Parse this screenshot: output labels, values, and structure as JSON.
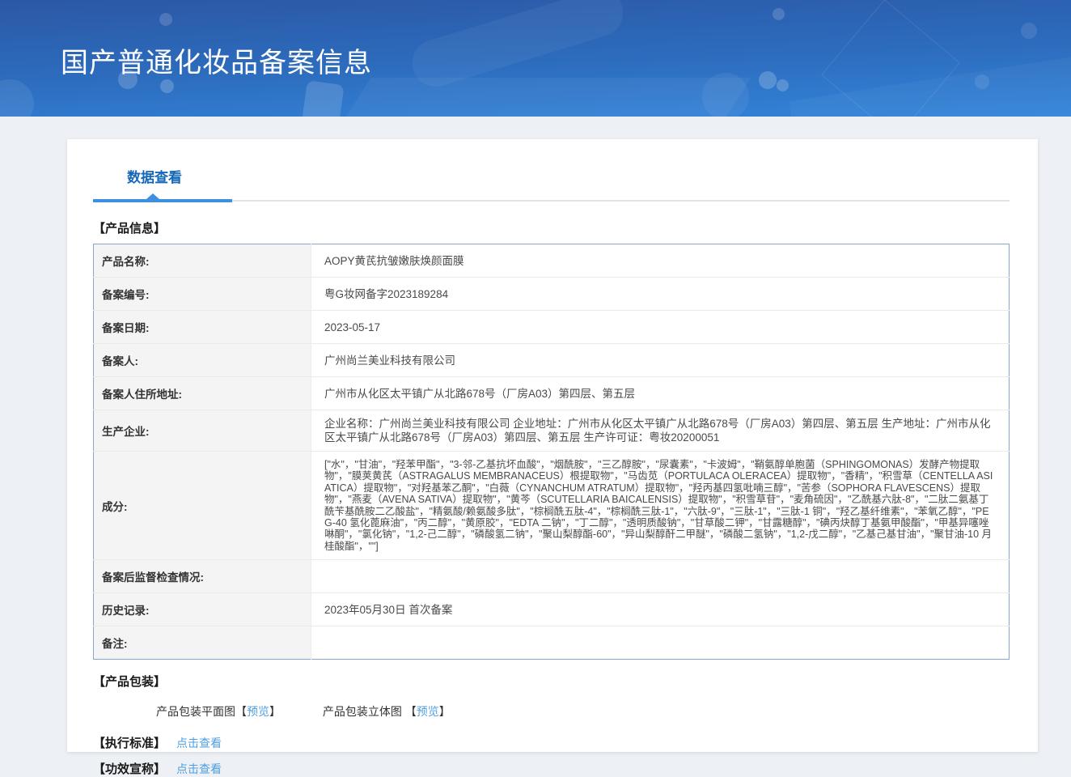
{
  "header": {
    "title": "国产普通化妆品备案信息"
  },
  "tab": {
    "label": "数据查看"
  },
  "product_info": {
    "title": "【产品信息】",
    "rows": [
      {
        "label": "产品名称:",
        "value": "AOPY黄芪抗皱嫩肤焕颜面膜"
      },
      {
        "label": "备案编号:",
        "value": "粤G妆网备字2023189284"
      },
      {
        "label": "备案日期:",
        "value": "2023-05-17"
      },
      {
        "label": "备案人:",
        "value": "广州尚兰美业科技有限公司"
      },
      {
        "label": "备案人住所地址:",
        "value": "广州市从化区太平镇广从北路678号（厂房A03）第四层、第五层"
      },
      {
        "label": "生产企业:",
        "value": "企业名称：广州尚兰美业科技有限公司 企业地址：广州市从化区太平镇广从北路678号（厂房A03）第四层、第五层 生产地址：广州市从化区太平镇广从北路678号（厂房A03）第四层、第五层 生产许可证：粤妆20200051"
      },
      {
        "label": "成分:",
        "value": "[\"水\"，\"甘油\"，\"羟苯甲酯\"，\"3-邻-乙基抗坏血酸\"，\"烟酰胺\"，\"三乙醇胺\"，\"尿囊素\"，\"卡波姆\"，\"鞘氨醇单胞菌（SPHINGOMONAS）发酵产物提取物\"，\"膜荚黄芪（ASTRAGALUS MEMBRANACEUS）根提取物\"，\"马齿苋（PORTULACA OLERACEA）提取物\"，\"香精\"，\"积雪草（CENTELLA ASIATICA）提取物\"，\"对羟基苯乙酮\"，\"白薇（CYNANCHUM ATRATUM）提取物\"，\"羟丙基四氢吡喃三醇\"，\"苦参（SOPHORA FLAVESCENS）提取物\"，\"燕麦（AVENA SATIVA）提取物\"，\"黄芩（SCUTELLARIA BAICALENSIS）提取物\"，\"积雪草苷\"，\"麦角硫因\"，\"乙酰基六肽-8\"，\"二肽二氨基丁酰苄基酰胺二乙酸盐\"，\"精氨酸/赖氨酸多肽\"，\"棕榈酰五肽-4\"，\"棕榈酰三肽-1\"，\"六肽-9\"，\"三肽-1\"，\"三肽-1 铜\"，\"羟乙基纤维素\"，\"苯氧乙醇\"，\"PEG-40 氢化蓖麻油\"，\"丙二醇\"，\"黄原胶\"，\"EDTA 二钠\"，\"丁二醇\"，\"透明质酸钠\"，\"甘草酸二钾\"，\"甘露糖醇\"，\"碘丙炔醇丁基氨甲酸酯\"，\"甲基异噻唑啉酮\"，\"氯化钠\"，\"1,2-己二醇\"，\"磷酸氢二钠\"，\"聚山梨醇酯-60\"，\"异山梨醇酐二甲醚\"，\"磷酸二氢钠\"，\"1,2-戊二醇\"，\"乙基己基甘油\"，\"聚甘油-10 月桂酸酯\"，\"\"]"
      },
      {
        "label": "备案后监督检查情况:",
        "value": ""
      },
      {
        "label": "历史记录:",
        "value": "2023年05月30日 首次备案"
      },
      {
        "label": "备注:",
        "value": ""
      }
    ]
  },
  "packaging": {
    "title": "【产品包装】",
    "bracket_open": "【",
    "bracket_close": "】",
    "items": [
      {
        "label": "产品包装平面图",
        "link": "预览"
      },
      {
        "label": "产品包装立体图",
        "link": "预览"
      }
    ]
  },
  "execution_standard": {
    "title": "【执行标准】",
    "link": "点击查看"
  },
  "efficacy_claim": {
    "title": "【功效宣称】",
    "link": "点击查看"
  },
  "colors": {
    "banner_gradient_top": "#2b58a6",
    "banner_gradient_bottom": "#3384da",
    "tab_text": "#1568b8",
    "tab_underline": "#3d8fe0",
    "link_blue": "#4f9fe0",
    "table_border": "#86a6d4",
    "label_cell_bg": "#f4f4f4",
    "page_bg": "#edf0f4"
  }
}
